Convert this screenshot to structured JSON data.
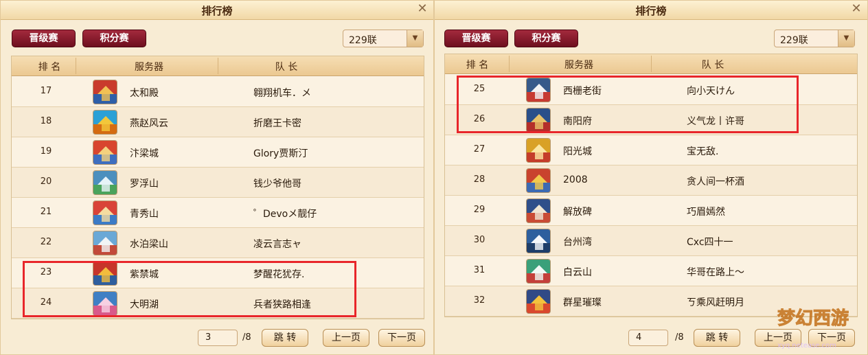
{
  "left": {
    "title": "排行榜",
    "tabs": [
      "晋级赛",
      "积分赛"
    ],
    "server_group": "229联",
    "headers": [
      "排 名",
      "服务器",
      "队 长"
    ],
    "rows": [
      {
        "rank": "17",
        "server": "太和殿",
        "captain": "翱翔机车．メ",
        "icon": "palace-icon"
      },
      {
        "rank": "18",
        "server": "燕赵风云",
        "captain": "折磨王卡密",
        "icon": "dream-logo-icon"
      },
      {
        "rank": "19",
        "server": "汴梁城",
        "captain": "Glory贾斯汀",
        "icon": "city-gate-icon"
      },
      {
        "rank": "20",
        "server": "罗浮山",
        "captain": "钱少爷他哥",
        "icon": "mountain-icon"
      },
      {
        "rank": "21",
        "server": "青秀山",
        "captain": "゜Devoメ靓仔",
        "icon": "pavilion-icon"
      },
      {
        "rank": "22",
        "server": "水泊梁山",
        "captain": "凌云言志ャ",
        "icon": "peak-icon"
      },
      {
        "rank": "23",
        "server": "紫禁城",
        "captain": "梦醒花犹存.",
        "icon": "forbidden-city-icon"
      },
      {
        "rank": "24",
        "server": "大明湖",
        "captain": "兵者狭路相逢",
        "icon": "lake-icon"
      }
    ],
    "page": "3",
    "total": "/8",
    "buttons": {
      "jump": "跳 转",
      "prev": "上一页",
      "next": "下一页"
    }
  },
  "right": {
    "title": "排行榜",
    "tabs": [
      "晋级赛",
      "积分赛"
    ],
    "server_group": "229联",
    "headers": [
      "排 名",
      "服务器",
      "队 长"
    ],
    "rows": [
      {
        "rank": "25",
        "server": "西栅老街",
        "captain": "向小天けん",
        "icon": "old-street-icon"
      },
      {
        "rank": "26",
        "server": "南阳府",
        "captain": "义气龙丨许哥",
        "icon": "mansion-icon"
      },
      {
        "rank": "27",
        "server": "阳光城",
        "captain": "宝无敌.",
        "icon": "sun-tower-icon"
      },
      {
        "rank": "28",
        "server": "2008",
        "captain": "贪人间一杯酒",
        "icon": "stadium-icon"
      },
      {
        "rank": "29",
        "server": "解放碑",
        "captain": "巧眉嫣然",
        "icon": "monument-icon"
      },
      {
        "rank": "30",
        "server": "台州湾",
        "captain": "Cxc四十一",
        "icon": "bay-bridge-icon"
      },
      {
        "rank": "31",
        "server": "白云山",
        "captain": "华哥在路上～",
        "icon": "cloud-mountain-icon"
      },
      {
        "rank": "32",
        "server": "群星璀璨",
        "captain": "ㄎ乘风赶明月",
        "icon": "star-icon"
      }
    ],
    "page": "4",
    "total": "/8",
    "buttons": {
      "jump": "跳 转",
      "prev": "上一页",
      "next": "下一页"
    }
  },
  "watermark": {
    "text": "梦幻西游",
    "url": "xyq.netease.com"
  },
  "colors": {
    "tab_bg": "#8b1a2c",
    "highlight_border": "#e8262a",
    "panel_bg": "#f8ecd4"
  }
}
